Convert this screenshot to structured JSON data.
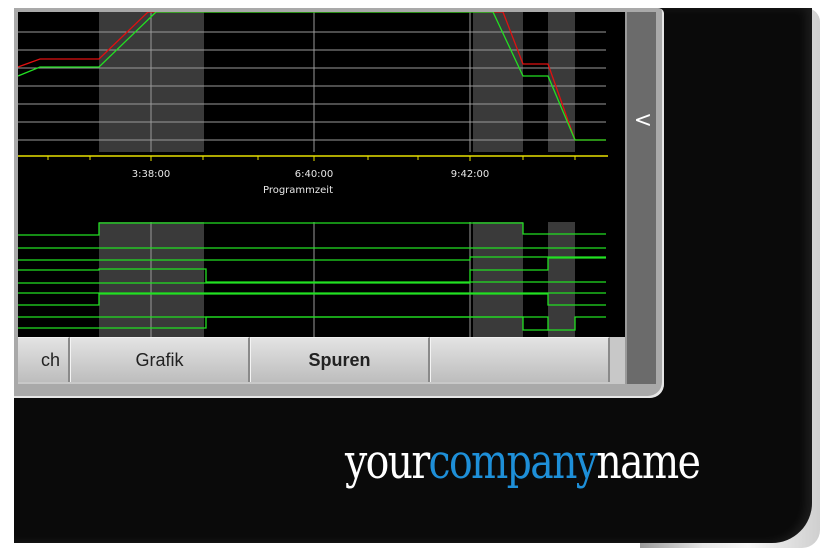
{
  "axis": {
    "x_title": "Programmzeit",
    "ticks": [
      "3:38:00",
      "6:40:00",
      "9:42:00"
    ]
  },
  "tabs": [
    {
      "label": "ch",
      "bold": false
    },
    {
      "label": "Grafik",
      "bold": false
    },
    {
      "label": "Spuren",
      "bold": true
    },
    {
      "label": "",
      "bold": false
    }
  ],
  "side": {
    "collapse_icon": "<"
  },
  "logo": {
    "part1": "your",
    "part2": "company",
    "part3": "name"
  },
  "colors": {
    "red_trace": "#e01010",
    "green_trace": "#22e022",
    "axis": "#e8e000",
    "shade": "#3a3a3a",
    "logo_blue": "#1e8fd8"
  }
}
